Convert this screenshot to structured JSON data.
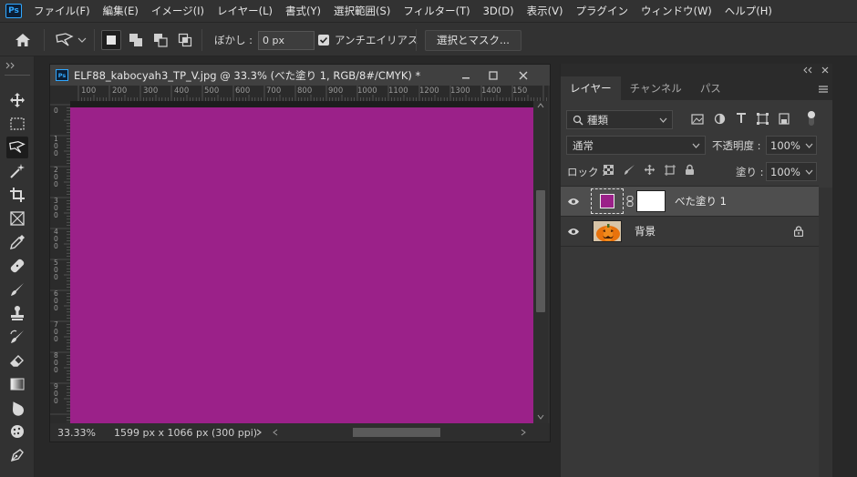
{
  "menubar": {
    "logo": "Ps",
    "items": [
      "ファイル(F)",
      "編集(E)",
      "イメージ(I)",
      "レイヤー(L)",
      "書式(Y)",
      "選択範囲(S)",
      "フィルター(T)",
      "3D(D)",
      "表示(V)",
      "プラグイン",
      "ウィンドウ(W)",
      "ヘルプ(H)"
    ]
  },
  "options": {
    "feather_label": "ぼかし :",
    "feather_value": "0 px",
    "antialias_label": "アンチエイリアス",
    "antialias_checked": true,
    "select_mask_label": "選択とマスク..."
  },
  "document": {
    "title": "ELF88_kabocyah3_TP_V.jpg @ 33.3% (べた塗り 1, RGB/8#/CMYK) *",
    "ruler_h_ticks": [
      "100",
      "200",
      "300",
      "400",
      "500",
      "600",
      "700",
      "800",
      "900",
      "1000",
      "1100",
      "1200",
      "1300",
      "1400",
      "150"
    ],
    "ruler_v_labels": [
      "0",
      "100",
      "200",
      "300",
      "400",
      "500",
      "600",
      "700",
      "800",
      "900"
    ],
    "zoom": "33.33%",
    "doc_info": "1599 px x 1066 px (300 ppi)",
    "canvas_color": "#9b2189"
  },
  "layers_panel": {
    "tabs": [
      "レイヤー",
      "チャンネル",
      "パス"
    ],
    "filter_label": "種類",
    "blend_mode": "通常",
    "opacity_label": "不透明度 :",
    "opacity_value": "100%",
    "lock_label": "ロック :",
    "fill_label": "塗り :",
    "fill_value": "100%",
    "layers": [
      {
        "name": "べた塗り 1",
        "visible": true,
        "selected": true,
        "thumb_color": "#9b2189",
        "has_mask": true
      },
      {
        "name": "背景",
        "visible": true,
        "selected": false,
        "locked": true,
        "thumb": "pumpkin-image"
      }
    ]
  },
  "colors": {
    "accent": "#31a8ff",
    "panel_bg": "#383838",
    "app_bg": "#282828",
    "fill_color": "#9b2189"
  }
}
